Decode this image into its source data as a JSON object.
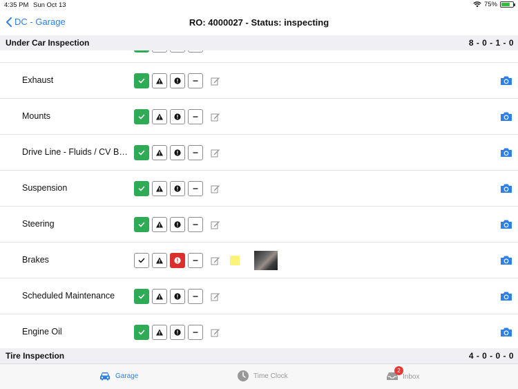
{
  "status_bar": {
    "time": "4:35 PM",
    "date": "Sun Oct 13",
    "battery": "75%",
    "battery_level": 0.75
  },
  "nav": {
    "back_label": "DC - Garage",
    "title": "RO: 4000027 - Status: inspecting"
  },
  "sections": [
    {
      "title": "Under Car Inspection",
      "count": "8 - 0 - 1 - 0"
    },
    {
      "title": "Tire Inspection",
      "count": "4 - 0 - 0 - 0"
    }
  ],
  "items": [
    {
      "name": "Exhaust",
      "status": "ok"
    },
    {
      "name": "Mounts",
      "status": "ok"
    },
    {
      "name": "Drive Line - Fluids / CV Boots",
      "status": "ok"
    },
    {
      "name": "Suspension",
      "status": "ok"
    },
    {
      "name": "Steering",
      "status": "ok"
    },
    {
      "name": "Brakes",
      "status": "bad",
      "has_note": true,
      "has_photo": true
    },
    {
      "name": "Scheduled Maintenance",
      "status": "ok"
    },
    {
      "name": "Engine Oil",
      "status": "ok"
    }
  ],
  "tabs": [
    {
      "label": "Garage",
      "icon": "car-icon",
      "active": true
    },
    {
      "label": "Time Clock",
      "icon": "clock-icon",
      "active": false
    },
    {
      "label": "Inbox",
      "icon": "inbox-icon",
      "active": false,
      "badge": "2"
    }
  ],
  "colors": {
    "accent": "#2f7fe8",
    "ok": "#2faa55",
    "bad": "#d9302c",
    "note": "#fbf37a"
  }
}
